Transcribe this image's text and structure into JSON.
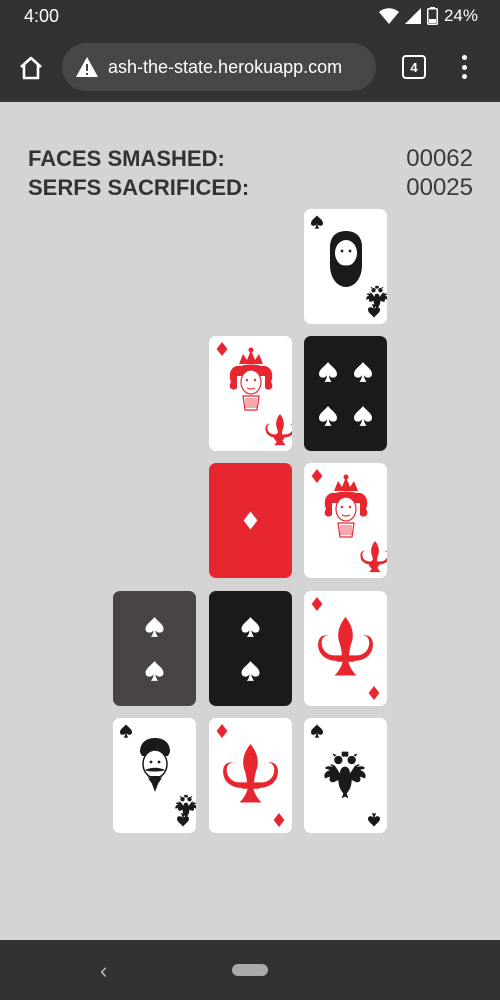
{
  "status_bar": {
    "time": "4:00",
    "battery": "24%"
  },
  "browser": {
    "url": "ash-the-state.herokuapp.com",
    "tab_count": "4"
  },
  "score": {
    "faces_label": "FACES SMASHED:",
    "faces_value": "00062",
    "serfs_label": "SERFS SACRIFICED:",
    "serfs_value": "00025"
  },
  "cards": [
    {
      "column": 3,
      "row": 1,
      "kind": "face",
      "suit": "spade",
      "figure": "bearded-face",
      "back": "white"
    },
    {
      "column": 2,
      "row": 2,
      "kind": "face",
      "suit": "diamond",
      "figure": "crowned-queen",
      "back": "white"
    },
    {
      "column": 3,
      "row": 2,
      "kind": "pips",
      "suit": "spade",
      "pips": 4,
      "back": "black"
    },
    {
      "column": 2,
      "row": 3,
      "kind": "pips",
      "suit": "diamond",
      "pips": 1,
      "back": "red"
    },
    {
      "column": 3,
      "row": 3,
      "kind": "face",
      "suit": "diamond",
      "figure": "crowned-queen",
      "back": "white"
    },
    {
      "column": 1,
      "row": 4,
      "kind": "pips",
      "suit": "spade",
      "pips": 2,
      "back": "grey"
    },
    {
      "column": 2,
      "row": 4,
      "kind": "pips",
      "suit": "spade",
      "pips": 2,
      "back": "black"
    },
    {
      "column": 3,
      "row": 4,
      "kind": "ace",
      "suit": "diamond",
      "figure": "fleur-de-lis",
      "back": "white"
    },
    {
      "column": 1,
      "row": 5,
      "kind": "face",
      "suit": "spade",
      "figure": "mustached-face",
      "back": "white"
    },
    {
      "column": 2,
      "row": 5,
      "kind": "ace",
      "suit": "diamond",
      "figure": "fleur-de-lis",
      "back": "white"
    },
    {
      "column": 3,
      "row": 5,
      "kind": "ace",
      "suit": "spade",
      "figure": "double-headed-eagle",
      "back": "white"
    }
  ],
  "colors": {
    "red": "#e8262f",
    "black": "#1a1a1a",
    "grey": "#484444",
    "background": "#d4d4d4"
  }
}
